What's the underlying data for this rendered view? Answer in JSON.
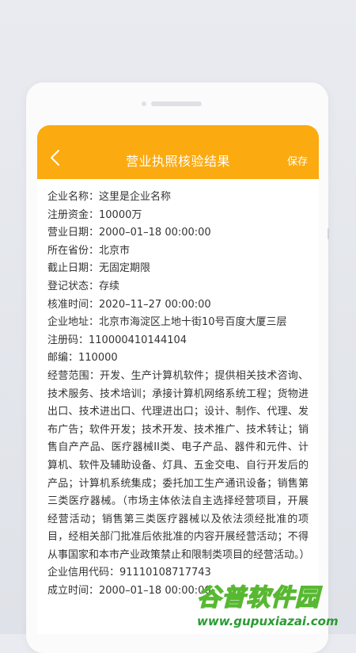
{
  "header": {
    "title": "营业执照核验结果",
    "save_label": "保存",
    "back_icon": "chevron-left-icon"
  },
  "fields": [
    {
      "label": "企业名称：",
      "value": "这里是企业名称"
    },
    {
      "label": "注册资金：",
      "value": "10000万"
    },
    {
      "label": "营业日期：",
      "value": "2000–01–18  00:00:00"
    },
    {
      "label": "所在省份：",
      "value": "北京市"
    },
    {
      "label": "截止日期：",
      "value": "无固定期限"
    },
    {
      "label": "登记状态：",
      "value": "存续"
    },
    {
      "label": "核准时间：",
      "value": "2020–11–27  00:00:00"
    },
    {
      "label": "企业地址：",
      "value": "北京市海淀区上地十街10号百度大厦三层"
    },
    {
      "label": "注册码：",
      "value": "110000410144104"
    },
    {
      "label": "邮编：",
      "value": "110000"
    }
  ],
  "scope": {
    "label": "经营范围：",
    "value": "开发、生产计算机软件；提供相关技术咨询、技术服务、技术培训；承接计算机网络系统工程；货物进出口、技术进出口、代理进出口；设计、制作、代理、发布广告；软件开发；技术开发、技术推广、技术转让；销售自产产品、医疗器械II类、电子产品、器件和元件、计算机、软件及辅助设备、灯具、五金交电、自行开发后的产品；计算机系统集成；委托加工生产通讯设备；销售第三类医疗器械。（市场主体依法自主选择经营项目，开展经营活动；销售第三类医疗器械以及依法须经批准的项目，经相关部门批准后依批准的内容开展经营活动；不得从事国家和本市产业政策禁止和限制类项目的经营活动。）"
  },
  "tail_fields": [
    {
      "label": "企业信用代码：",
      "value": "91110108717743"
    },
    {
      "label": "成立时间：",
      "value": "2000–01–18  00:00:00"
    }
  ],
  "watermark": {
    "main": "谷普软件园",
    "sub": "www.gupuxiazai.com"
  },
  "colors": {
    "header": "#fbaa10",
    "text": "#333333",
    "background": "#e9ebf0"
  }
}
